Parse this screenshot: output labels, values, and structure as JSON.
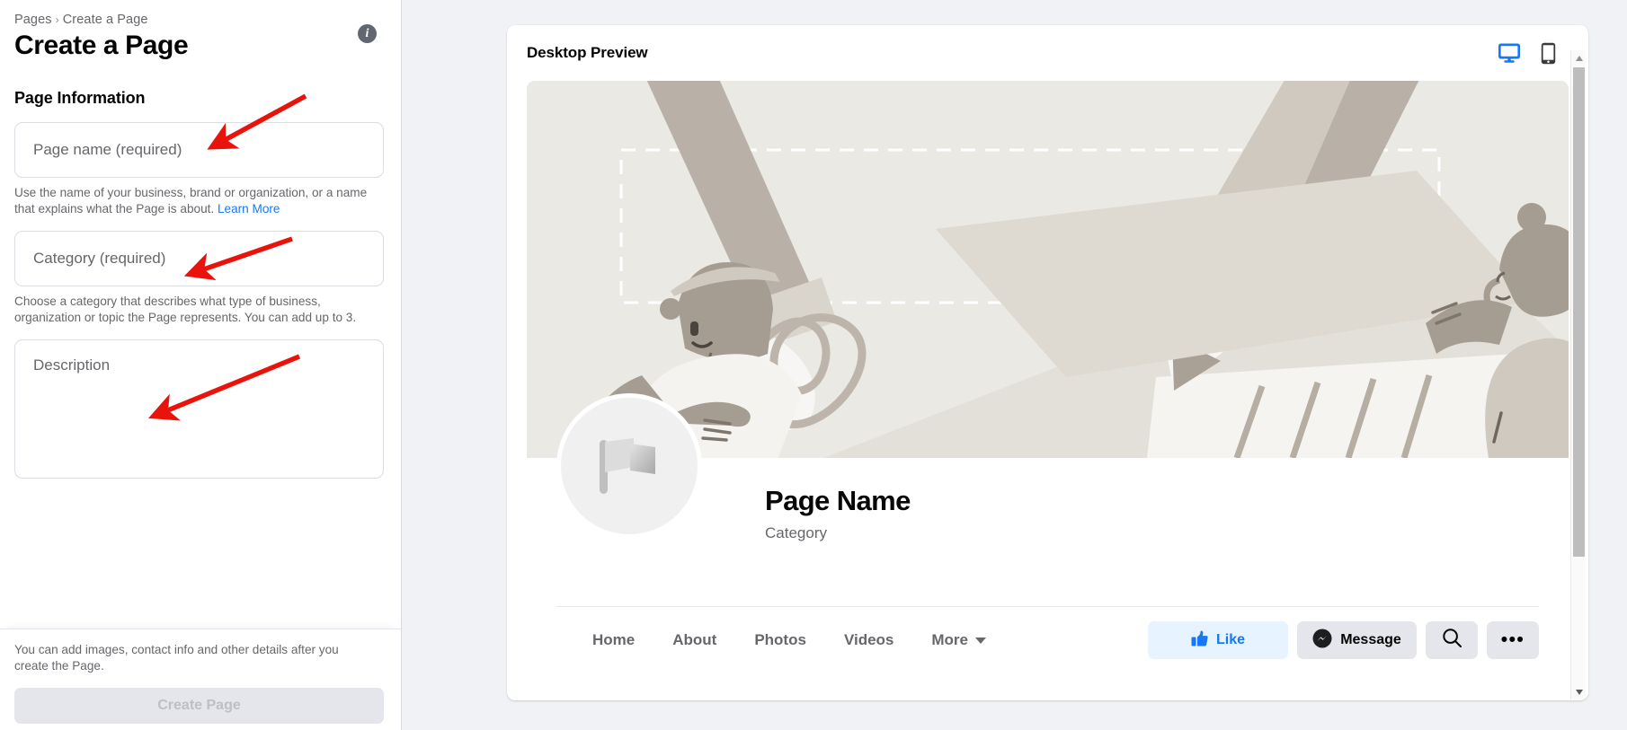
{
  "left": {
    "breadcrumb": {
      "root": "Pages",
      "separator": "›",
      "current": "Create a Page"
    },
    "title": "Create a Page",
    "info_icon_label": "i",
    "section_title": "Page Information",
    "fields": [
      {
        "name": "page-name",
        "placeholder": "Page name (required)",
        "value": "",
        "help_before": "Use the name of your business, brand or organization, or a name that explains what the Page is about. ",
        "help_link": "Learn More"
      },
      {
        "name": "category",
        "placeholder": "Category (required)",
        "value": "",
        "help_before": "Choose a category that describes what type of business, organization or topic the Page represents. You can add up to 3.",
        "help_link": ""
      },
      {
        "name": "description",
        "placeholder": "Description",
        "value": "",
        "help_before": "",
        "help_link": ""
      }
    ],
    "footer_note": "You can add images, contact info and other details after you create the Page.",
    "create_button": "Create Page"
  },
  "preview": {
    "title": "Desktop Preview",
    "devices": [
      {
        "icon": "desktop-monitor-icon",
        "active": true
      },
      {
        "icon": "mobile-phone-icon",
        "active": false
      }
    ],
    "page_name": "Page Name",
    "page_category": "Category",
    "avatar_icon": "flag-placeholder-icon",
    "nav_tabs": [
      {
        "label": "Home",
        "has_caret": false
      },
      {
        "label": "About",
        "has_caret": false
      },
      {
        "label": "Photos",
        "has_caret": false
      },
      {
        "label": "Videos",
        "has_caret": false
      },
      {
        "label": "More",
        "has_caret": true
      }
    ],
    "actions": [
      {
        "label": "Like",
        "icon": "thumbs-up-icon"
      },
      {
        "label": "Message",
        "icon": "messenger-icon"
      },
      {
        "label": "",
        "icon": "search-icon"
      },
      {
        "label": "",
        "icon": "ellipsis-icon"
      }
    ]
  },
  "colors": {
    "brand_blue": "#1877F2",
    "like_bg": "#E7F3FF",
    "neutral_bg": "#E4E6EB",
    "page_bg": "#F0F2F5",
    "text_secondary": "#65676B",
    "annotation_red": "#E8140C"
  },
  "annotations": [
    {
      "name": "arrow-to-page-name-field",
      "target": "page-name-input"
    },
    {
      "name": "arrow-to-category-field",
      "target": "category-input"
    },
    {
      "name": "arrow-to-description-field",
      "target": "description-textarea"
    }
  ]
}
